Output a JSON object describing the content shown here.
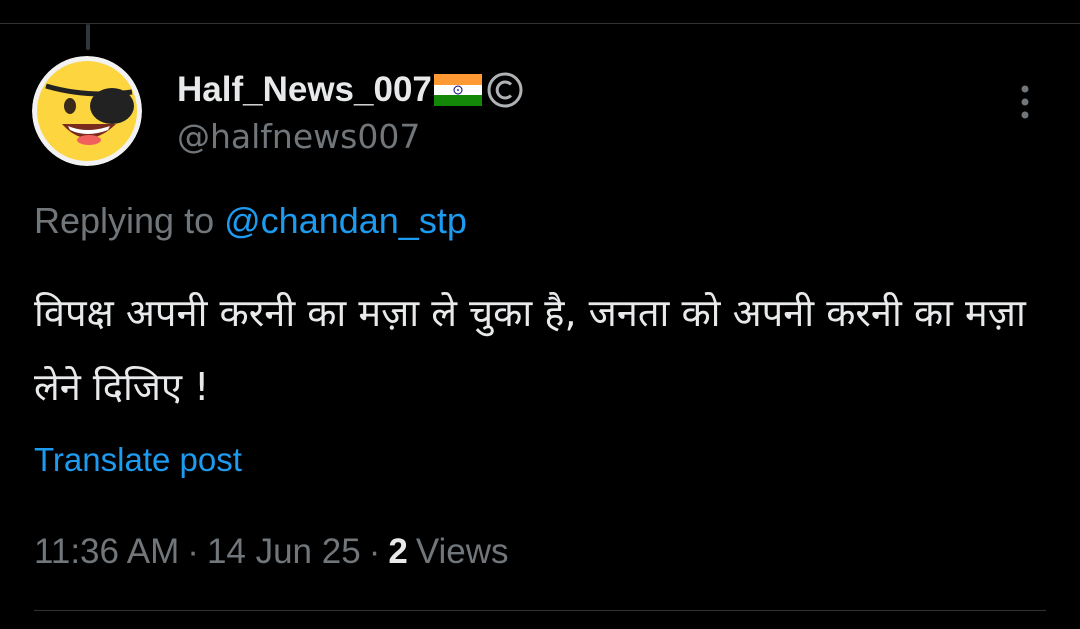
{
  "post": {
    "author": {
      "display_name": "Half_News_007",
      "handle": "@halfnews007",
      "avatar_icon": "eyepatch-emoji-avatar",
      "badges": [
        "india-flag-icon",
        "copyright-icon"
      ]
    },
    "replying_prefix": "Replying to",
    "replying_to": "@chandan_stp",
    "text": "विपक्ष अपनी करनी का मज़ा ले चुका है, जनता को अपनी करनी का मज़ा लेने दिजिए !",
    "translate_label": "Translate post",
    "time": "11:36 AM",
    "separator": "·",
    "date": "14 Jun 25",
    "views_count": "2",
    "views_label": "Views"
  },
  "colors": {
    "background": "#000000",
    "text_primary": "#e7e9ea",
    "text_secondary": "#71767b",
    "link": "#1d9bf0",
    "divider": "#2f3336"
  }
}
